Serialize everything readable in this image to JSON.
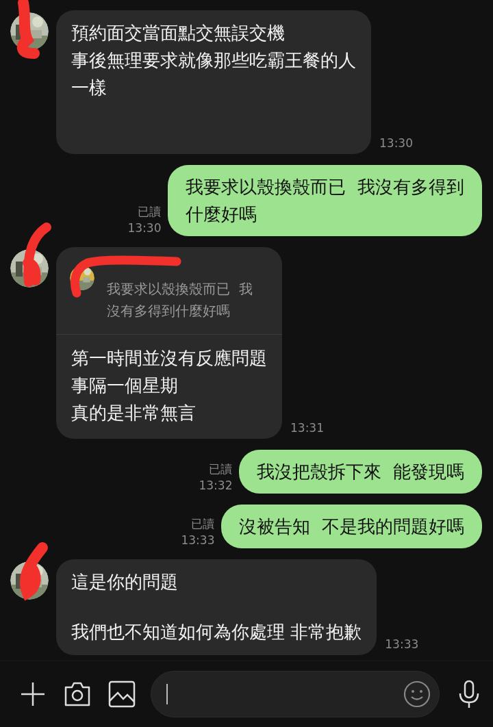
{
  "messages": [
    {
      "kind": "incoming",
      "paragraphs": [
        [
          "預約面交當面點交無誤交機",
          "事後無理要求就像那些吃霸王餐的人",
          "一樣"
        ]
      ],
      "time": "13:30"
    },
    {
      "kind": "outgoing",
      "paragraphs": [
        [
          "我要求以殼換殼而已  我沒有多得到",
          "什麼好嗎"
        ]
      ],
      "read": "已讀",
      "time": "13:30"
    },
    {
      "kind": "incoming",
      "quote": [
        "我要求以殼換殼而已  我",
        "沒有多得到什麼好嗎"
      ],
      "paragraphs": [
        [
          "第一時間並沒有反應問題",
          "事隔一個星期",
          "真的是非常無言"
        ]
      ],
      "time": "13:31"
    },
    {
      "kind": "outgoing",
      "paragraphs": [
        [
          "我沒把殼拆下來  能發現嗎"
        ]
      ],
      "read": "已讀",
      "time": "13:32"
    },
    {
      "kind": "outgoing",
      "paragraphs": [
        [
          "沒被告知  不是我的問題好嗎"
        ]
      ],
      "read": "已讀",
      "time": "13:33"
    },
    {
      "kind": "incoming",
      "paragraphs": [
        [
          "這是你的問題"
        ],
        [
          "我們也不知道如何為你處理 非常抱歉"
        ]
      ],
      "time": "13:33"
    }
  ]
}
